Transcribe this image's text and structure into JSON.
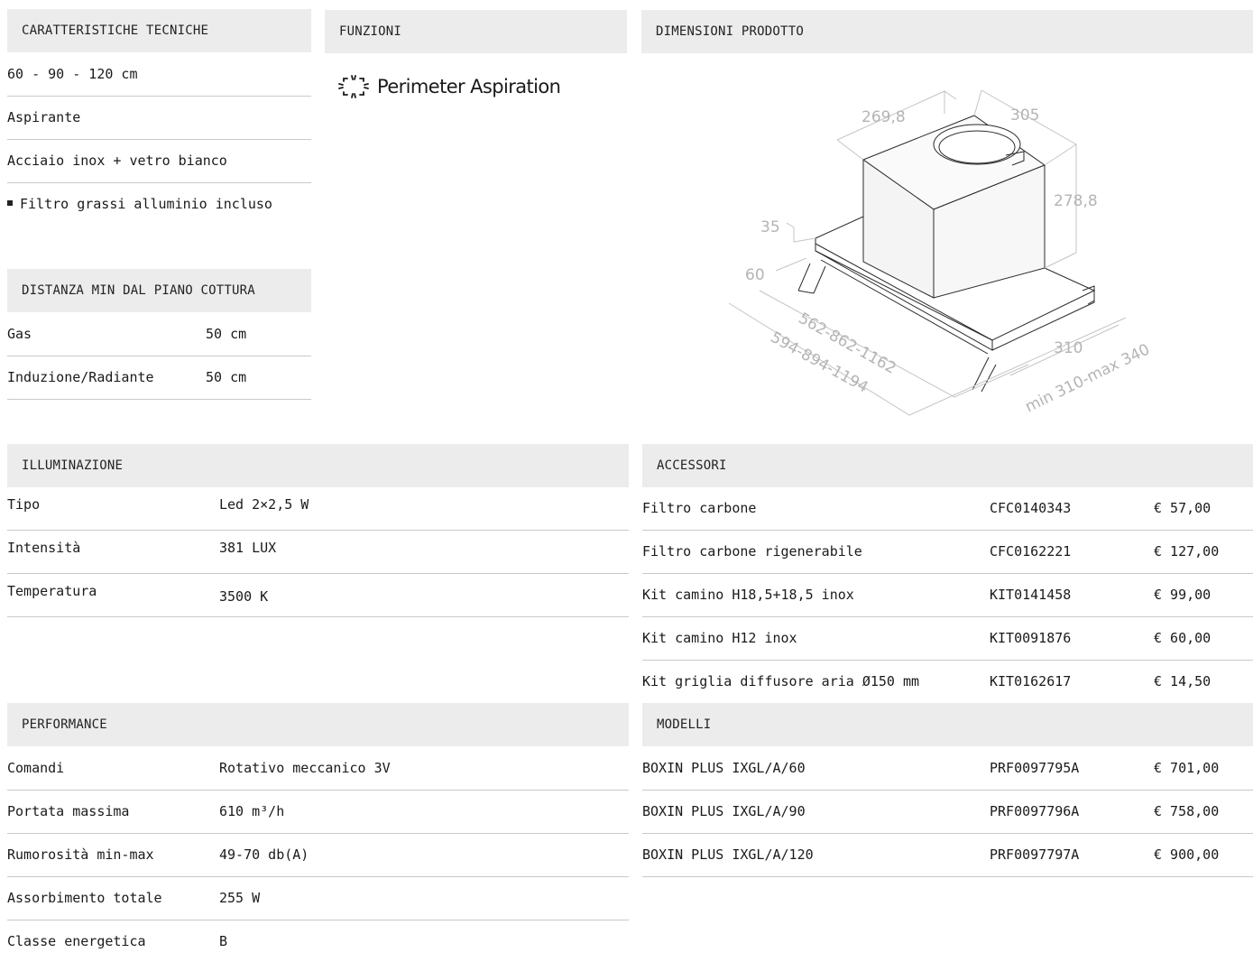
{
  "tech": {
    "title": "CARATTERISTICHE TECNICHE",
    "rows": [
      "60 - 90 - 120 cm",
      "Aspirante",
      "Acciaio inox + vetro bianco",
      "Filtro grassi alluminio incluso"
    ]
  },
  "functions": {
    "title": "FUNZIONI",
    "feature": "Perimeter Aspiration"
  },
  "dimensions": {
    "title": "DIMENSIONI PRODOTTO",
    "labels": {
      "a": "269,8",
      "b": "305",
      "c": "278,8",
      "d": "35",
      "e": "60",
      "f": "562-862-1162",
      "g": "594-894-1194",
      "h": "310",
      "i": "min 310-max 340"
    }
  },
  "distance": {
    "title": "DISTANZA MIN DAL PIANO COTTURA",
    "rows": [
      {
        "label": "Gas",
        "value": "50 cm"
      },
      {
        "label": "Induzione/Radiante",
        "value": "50 cm"
      }
    ]
  },
  "lighting": {
    "title": "ILLUMINAZIONE",
    "rows": [
      {
        "label": "Tipo",
        "value": "Led 2×2,5 W"
      },
      {
        "label": "Intensità",
        "value": "381 LUX"
      },
      {
        "label": "Temperatura",
        "value": "3500 K"
      }
    ]
  },
  "accessories": {
    "title": "ACCESSORI",
    "rows": [
      {
        "name": "Filtro carbone",
        "code": "CFC0140343",
        "price": "€ 57,00"
      },
      {
        "name": "Filtro carbone rigenerabile",
        "code": "CFC0162221",
        "price": "€ 127,00"
      },
      {
        "name": "Kit camino H18,5+18,5 inox",
        "code": "KIT0141458",
        "price": "€ 99,00"
      },
      {
        "name": "Kit camino H12 inox",
        "code": "KIT0091876",
        "price": "€ 60,00"
      },
      {
        "name": "Kit griglia diffusore aria Ø150 mm",
        "code": "KIT0162617",
        "price": "€ 14,50"
      }
    ]
  },
  "performance": {
    "title": "PERFORMANCE",
    "rows": [
      {
        "label": "Comandi",
        "value": "Rotativo meccanico 3V"
      },
      {
        "label": "Portata massima",
        "value": "610 m³/h"
      },
      {
        "label": "Rumorosità min-max",
        "value": "49-70 db(A)"
      },
      {
        "label": "Assorbimento totale",
        "value": "255 W"
      },
      {
        "label": "Classe energetica",
        "value": "B"
      }
    ]
  },
  "models": {
    "title": "MODELLI",
    "rows": [
      {
        "name": "BOXIN PLUS IXGL/A/60",
        "code": "PRF0097795A",
        "price": "€ 701,00"
      },
      {
        "name": "BOXIN PLUS IXGL/A/90",
        "code": "PRF0097796A",
        "price": "€ 758,00"
      },
      {
        "name": "BOXIN PLUS IXGL/A/120",
        "code": "PRF0097797A",
        "price": "€ 900,00"
      }
    ]
  }
}
